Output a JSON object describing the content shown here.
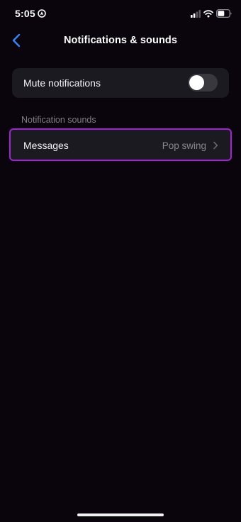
{
  "status_bar": {
    "time": "5:05",
    "location_icon": "location-arrow-icon",
    "signal_icon": "cellular-signal-icon",
    "wifi_icon": "wifi-icon",
    "battery_icon": "battery-icon"
  },
  "header": {
    "back_icon": "chevron-left-icon",
    "title": "Notifications & sounds"
  },
  "settings": {
    "mute": {
      "label": "Mute notifications",
      "enabled": false
    },
    "section_title": "Notification sounds",
    "messages": {
      "label": "Messages",
      "value": "Pop swing",
      "chevron_icon": "chevron-right-icon"
    }
  },
  "colors": {
    "background": "#0a050d",
    "card": "#1c1a21",
    "accent_back": "#3b82f6",
    "highlight_border": "#a321d6",
    "secondary_text": "#8a8790",
    "toggle_off": "#3a383f"
  }
}
